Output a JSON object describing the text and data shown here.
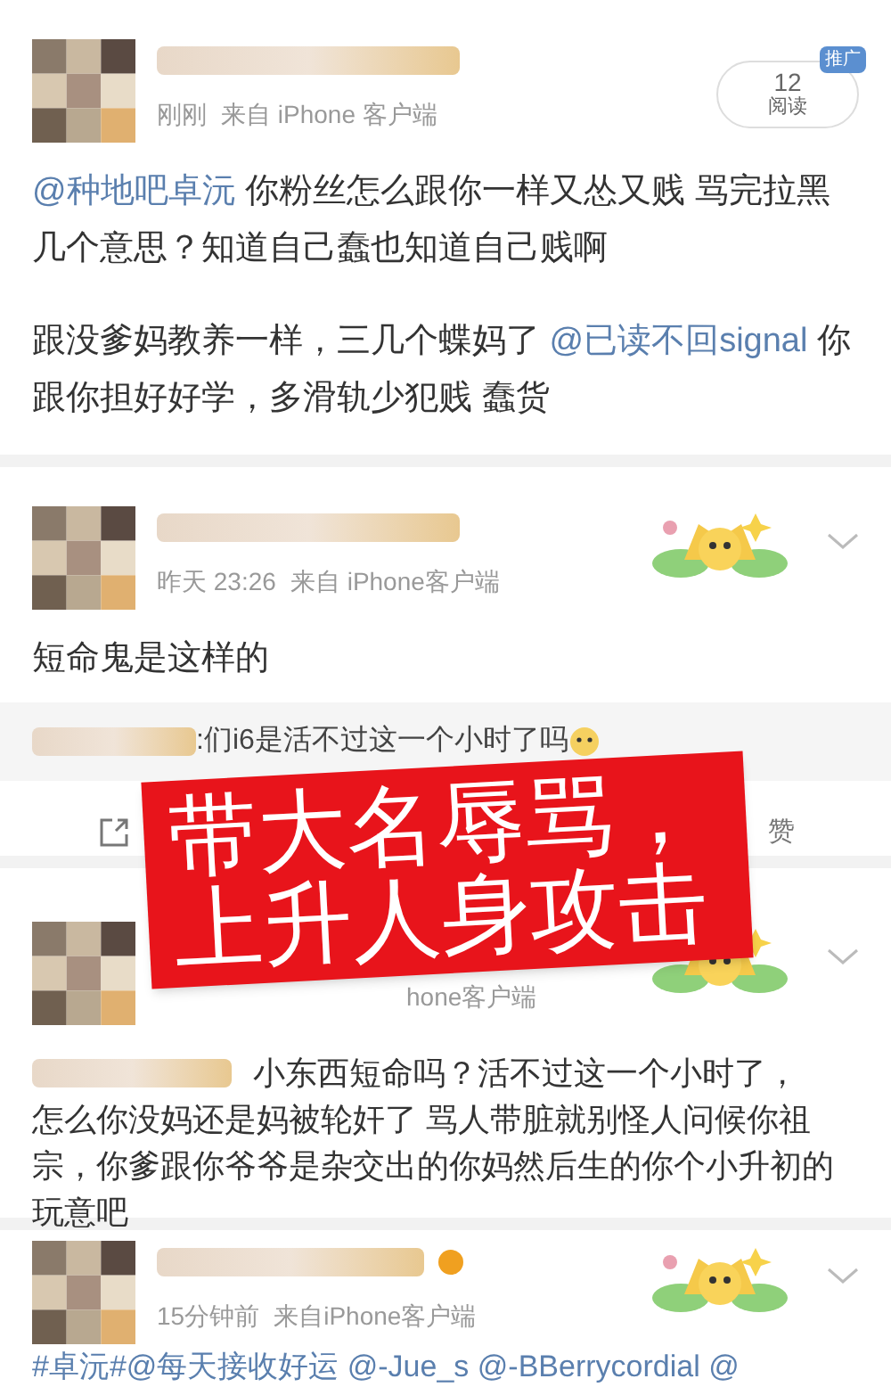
{
  "posts": [
    {
      "kind": "promoted",
      "time": "刚刚",
      "source": "来自 iPhone 客户端",
      "reads": {
        "count": "12",
        "label": "阅读",
        "tag": "推广"
      },
      "paragraphs": [
        [
          {
            "kind": "mention",
            "text": "@种地吧卓沅"
          },
          {
            "kind": "plain",
            "text": " 你粉丝怎么跟你一样又怂又贱  骂完拉黑几个意思？知道自己蠢也知道自己贱啊"
          }
        ],
        [
          {
            "kind": "plain",
            "text": "跟没爹妈教养一样，三几个蝶妈了 "
          },
          {
            "kind": "mention",
            "text": "@已读不回signal"
          },
          {
            "kind": "plain",
            "text": " 你跟你担好好学，多滑轨少犯贱  蠢货"
          }
        ]
      ]
    },
    {
      "kind": "comment",
      "time": "昨天 23:26",
      "source": "来自 iPhone客户端",
      "paragraphs": [
        [
          {
            "kind": "plain",
            "text": "短命鬼是这样的"
          }
        ]
      ],
      "quote": ":们i6是活不过这一个小时了吗",
      "like": "赞"
    },
    {
      "kind": "comment",
      "source": "hone客户端",
      "blurred_mention": true,
      "paragraphs": [
        [
          {
            "kind": "plain",
            "text": "小东西短命吗？活不过这一个小时了，"
          }
        ],
        [
          {
            "kind": "plain",
            "text": "怎么你没妈还是妈被轮奸了  骂人带脏就别怪人问候你祖宗，你爹跟你爷爷是杂交出的你妈然后生的你个小升初的玩意吧"
          }
        ]
      ]
    },
    {
      "kind": "comment",
      "time": "15分钟前",
      "source": "来自iPhone客户端",
      "verified": true,
      "paragraphs": [
        [
          {
            "kind": "mention",
            "text": "#卓沅#@每天接收好运 @-Jue_s @-BBerrycordial @"
          }
        ]
      ]
    }
  ],
  "overlay": {
    "lines": [
      "带大名辱骂，",
      "上升人身攻击"
    ]
  }
}
